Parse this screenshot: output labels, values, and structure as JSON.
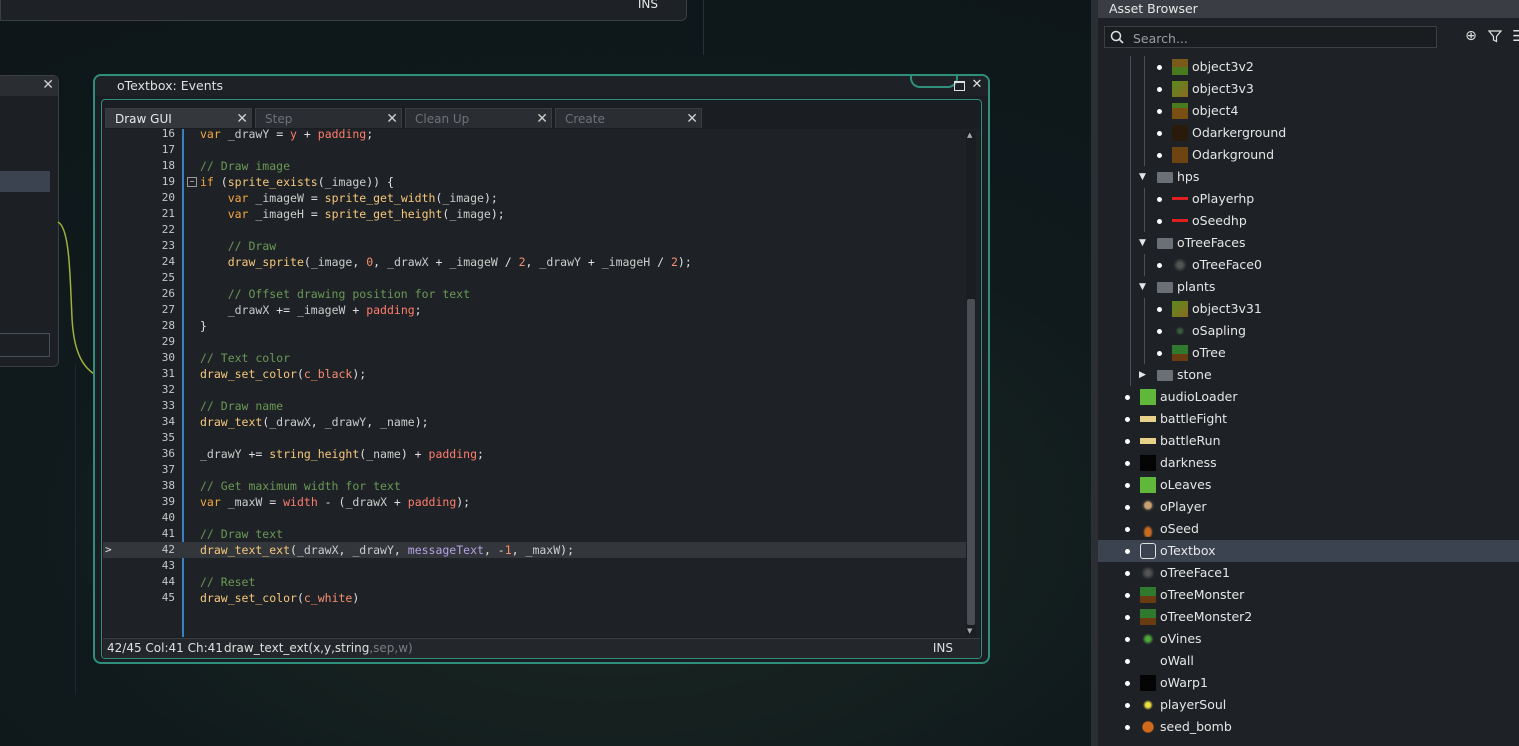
{
  "top_window": {
    "ins": "INS"
  },
  "events_window": {
    "title": "oTextbox: Events",
    "tabs": [
      {
        "label": "Draw GUI",
        "active": true
      },
      {
        "label": "Step",
        "active": false
      },
      {
        "label": "Clean Up",
        "active": false
      },
      {
        "label": "Create",
        "active": false
      }
    ],
    "code_lines": [
      {
        "n": "16",
        "text": "var _drawY = y + padding;"
      },
      {
        "n": "17",
        "text": ""
      },
      {
        "n": "18",
        "text": "// Draw image"
      },
      {
        "n": "19",
        "text": "if (sprite_exists(_image)) {"
      },
      {
        "n": "20",
        "text": "    var _imageW = sprite_get_width(_image);"
      },
      {
        "n": "21",
        "text": "    var _imageH = sprite_get_height(_image);"
      },
      {
        "n": "22",
        "text": ""
      },
      {
        "n": "23",
        "text": "    // Draw"
      },
      {
        "n": "24",
        "text": "    draw_sprite(_image, 0, _drawX + _imageW / 2, _drawY + _imageH / 2);"
      },
      {
        "n": "25",
        "text": ""
      },
      {
        "n": "26",
        "text": "    // Offset drawing position for text"
      },
      {
        "n": "27",
        "text": "    _drawX += _imageW + padding;"
      },
      {
        "n": "28",
        "text": "}"
      },
      {
        "n": "29",
        "text": ""
      },
      {
        "n": "30",
        "text": "// Text color"
      },
      {
        "n": "31",
        "text": "draw_set_color(c_black);"
      },
      {
        "n": "32",
        "text": ""
      },
      {
        "n": "33",
        "text": "// Draw name"
      },
      {
        "n": "34",
        "text": "draw_text(_drawX, _drawY, _name);"
      },
      {
        "n": "35",
        "text": ""
      },
      {
        "n": "36",
        "text": "_drawY += string_height(_name) + padding;"
      },
      {
        "n": "37",
        "text": ""
      },
      {
        "n": "38",
        "text": "// Get maximum width for text"
      },
      {
        "n": "39",
        "text": "var _maxW = width - (_drawX + padding);"
      },
      {
        "n": "40",
        "text": ""
      },
      {
        "n": "41",
        "text": "// Draw text"
      },
      {
        "n": "42",
        "text": "draw_text_ext(_drawX, _drawY, messageText, -1, _maxW);"
      },
      {
        "n": "43",
        "text": ""
      },
      {
        "n": "44",
        "text": "// Reset"
      },
      {
        "n": "45",
        "text": "draw_set_color(c_white)"
      }
    ],
    "status": {
      "position": "42/45 Col:41 Ch:41",
      "signature_main": "draw_text_ext(x,y,string",
      "signature_rest": ",sep,w)",
      "mode": "INS"
    }
  },
  "asset_browser": {
    "title": "Asset Browser",
    "search_placeholder": "Search...",
    "items": [
      {
        "label": "object3v2",
        "depth": 2,
        "kind": "object",
        "icon": "object3v2-sprite"
      },
      {
        "label": "object3v3",
        "depth": 2,
        "kind": "object",
        "icon": "object3v3-sprite"
      },
      {
        "label": "object4",
        "depth": 2,
        "kind": "object",
        "icon": "object4-sprite"
      },
      {
        "label": "Odarkerground",
        "depth": 2,
        "kind": "object",
        "icon": "odarkerground-sprite"
      },
      {
        "label": "Odarkground",
        "depth": 2,
        "kind": "object",
        "icon": "odarkground-sprite"
      },
      {
        "label": "hps",
        "depth": 1,
        "kind": "folder-open"
      },
      {
        "label": "oPlayerhp",
        "depth": 2,
        "kind": "object",
        "icon": "red-line-sprite"
      },
      {
        "label": "oSeedhp",
        "depth": 2,
        "kind": "object",
        "icon": "red-line-sprite"
      },
      {
        "label": "oTreeFaces",
        "depth": 1,
        "kind": "folder-open"
      },
      {
        "label": "oTreeFace0",
        "depth": 2,
        "kind": "object",
        "icon": "tree-face-sprite"
      },
      {
        "label": "plants",
        "depth": 1,
        "kind": "folder-open"
      },
      {
        "label": "object3v31",
        "depth": 2,
        "kind": "object",
        "icon": "object3v31-sprite"
      },
      {
        "label": "oSapling",
        "depth": 2,
        "kind": "object",
        "icon": "sapling-sprite"
      },
      {
        "label": "oTree",
        "depth": 2,
        "kind": "object",
        "icon": "tree-sprite"
      },
      {
        "label": "stone",
        "depth": 1,
        "kind": "folder-closed"
      },
      {
        "label": "audioLoader",
        "depth": 0,
        "kind": "object",
        "icon": "green-square-sprite"
      },
      {
        "label": "battleFight",
        "depth": 0,
        "kind": "object",
        "icon": "fight-sprite"
      },
      {
        "label": "battleRun",
        "depth": 0,
        "kind": "object",
        "icon": "run-sprite"
      },
      {
        "label": "darkness",
        "depth": 0,
        "kind": "object",
        "icon": "dark-sprite"
      },
      {
        "label": "oLeaves",
        "depth": 0,
        "kind": "object",
        "icon": "green-square-sprite"
      },
      {
        "label": "oPlayer",
        "depth": 0,
        "kind": "object",
        "icon": "player-sprite"
      },
      {
        "label": "oSeed",
        "depth": 0,
        "kind": "object",
        "icon": "seed-sprite"
      },
      {
        "label": "oTextbox",
        "depth": 0,
        "kind": "object",
        "icon": "textbox-sprite",
        "selected": true
      },
      {
        "label": "oTreeFace1",
        "depth": 0,
        "kind": "object",
        "icon": "tree-face-sprite"
      },
      {
        "label": "oTreeMonster",
        "depth": 0,
        "kind": "object",
        "icon": "tree-sprite"
      },
      {
        "label": "oTreeMonster2",
        "depth": 0,
        "kind": "object",
        "icon": "tree-sprite"
      },
      {
        "label": "oVines",
        "depth": 0,
        "kind": "object",
        "icon": "vines-sprite"
      },
      {
        "label": "oWall",
        "depth": 0,
        "kind": "object",
        "icon": "none"
      },
      {
        "label": "oWarp1",
        "depth": 0,
        "kind": "object",
        "icon": "dark-sprite"
      },
      {
        "label": "playerSoul",
        "depth": 0,
        "kind": "object",
        "icon": "soul-sprite"
      },
      {
        "label": "seed_bomb",
        "depth": 0,
        "kind": "object",
        "icon": "bomb-sprite"
      }
    ]
  },
  "colors": {
    "accent": "#2f8f7a",
    "selection": "#3b4250",
    "gutter_line": "#3a7fbf"
  }
}
